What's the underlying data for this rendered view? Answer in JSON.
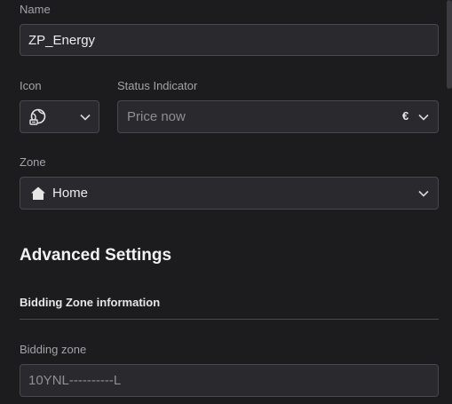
{
  "form": {
    "name": {
      "label": "Name",
      "value": "ZP_Energy"
    },
    "icon": {
      "label": "Icon",
      "icon_name": "energy-globe-icon"
    },
    "status_indicator": {
      "label": "Status Indicator",
      "placeholder": "Price now",
      "currency_symbol": "€"
    },
    "zone": {
      "label": "Zone",
      "value": "Home",
      "icon_name": "home-icon"
    }
  },
  "advanced": {
    "title": "Advanced Settings",
    "section_title": "Bidding Zone information",
    "bidding_zone": {
      "label": "Bidding zone",
      "value": "10YNL----------L"
    }
  },
  "colors": {
    "background": "#1c1c1f",
    "field_bg": "#2a2a2e",
    "border": "#48484d",
    "text": "#ececec",
    "muted": "#a4a4a8"
  }
}
